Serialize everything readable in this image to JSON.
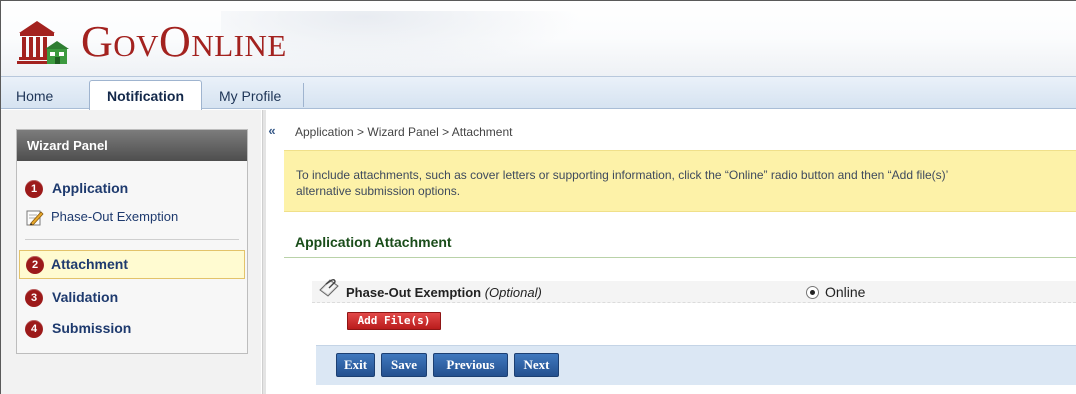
{
  "header": {
    "logo_text": "GovOnline",
    "colors": {
      "brand_red": "#a3221f",
      "nav_blue": "#1e3557"
    }
  },
  "nav": {
    "tabs": [
      {
        "label": "Home"
      },
      {
        "label": "Notification",
        "active": true
      },
      {
        "label": "My Profile"
      }
    ]
  },
  "sidebar": {
    "title": "Wizard Panel",
    "collapse_icon": "«",
    "steps": [
      {
        "num": "1",
        "label": "Application"
      },
      {
        "num": "2",
        "label": "Attachment",
        "active": true
      },
      {
        "num": "3",
        "label": "Validation"
      },
      {
        "num": "4",
        "label": "Submission"
      }
    ],
    "substep": {
      "label": "Phase-Out Exemption",
      "icon": "pencil-document-icon"
    }
  },
  "main": {
    "breadcrumb": "Application > Wizard Panel > Attachment",
    "info_line1": "To include attachments, such as cover letters or supporting information, click the “Online” radio button and then “Add file(s)’",
    "info_line2": "alternative submission options.",
    "section_title": "Application Attachment",
    "attachment": {
      "label": "Phase-Out Exemption",
      "optional": "(Optional)",
      "radio_label": "Online",
      "radio_selected": true,
      "add_file": "Add File(s)"
    },
    "buttons": {
      "exit": "Exit",
      "save": "Save",
      "previous": "Previous",
      "next": "Next"
    }
  }
}
